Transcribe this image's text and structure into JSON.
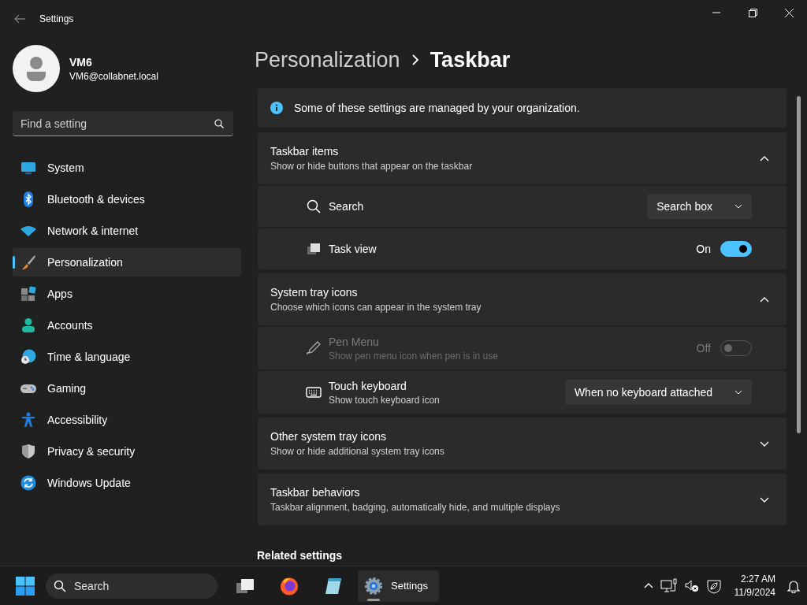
{
  "window": {
    "title": "Settings"
  },
  "profile": {
    "name": "VM6",
    "email": "VM6@collabnet.local"
  },
  "search": {
    "placeholder": "Find a setting"
  },
  "nav": [
    {
      "label": "System",
      "selected": false
    },
    {
      "label": "Bluetooth & devices",
      "selected": false
    },
    {
      "label": "Network & internet",
      "selected": false
    },
    {
      "label": "Personalization",
      "selected": true
    },
    {
      "label": "Apps",
      "selected": false
    },
    {
      "label": "Accounts",
      "selected": false
    },
    {
      "label": "Time & language",
      "selected": false
    },
    {
      "label": "Gaming",
      "selected": false
    },
    {
      "label": "Accessibility",
      "selected": false
    },
    {
      "label": "Privacy & security",
      "selected": false
    },
    {
      "label": "Windows Update",
      "selected": false
    }
  ],
  "breadcrumb": {
    "parent": "Personalization",
    "current": "Taskbar"
  },
  "notice": {
    "text": "Some of these settings are managed by your organization."
  },
  "groups": [
    {
      "title": "Taskbar items",
      "subtitle": "Show or hide buttons that appear on the taskbar",
      "expanded": true,
      "items": [
        {
          "kind": "dropdown",
          "label": "Search",
          "value": "Search box",
          "disabled": false
        },
        {
          "kind": "toggle",
          "label": "Task view",
          "state_label": "On",
          "on": true,
          "disabled": false
        }
      ]
    },
    {
      "title": "System tray icons",
      "subtitle": "Choose which icons can appear in the system tray",
      "expanded": true,
      "items": [
        {
          "kind": "toggle",
          "label": "Pen Menu",
          "description": "Show pen menu icon when pen is in use",
          "state_label": "Off",
          "on": false,
          "disabled": true
        },
        {
          "kind": "dropdown",
          "label": "Touch keyboard",
          "description": "Show touch keyboard icon",
          "value": "When no keyboard attached",
          "disabled": false
        }
      ]
    },
    {
      "title": "Other system tray icons",
      "subtitle": "Show or hide additional system tray icons",
      "expanded": false
    },
    {
      "title": "Taskbar behaviors",
      "subtitle": "Taskbar alignment, badging, automatically hide, and multiple displays",
      "expanded": false
    }
  ],
  "related": {
    "title": "Related settings"
  },
  "taskbar": {
    "search_placeholder": "Search",
    "apps": [
      {
        "selected": false
      },
      {
        "selected": false
      },
      {
        "selected": false
      },
      {
        "label": "Settings",
        "selected": true
      }
    ],
    "clock": {
      "time": "2:27 AM",
      "date": "11/9/2024"
    }
  }
}
